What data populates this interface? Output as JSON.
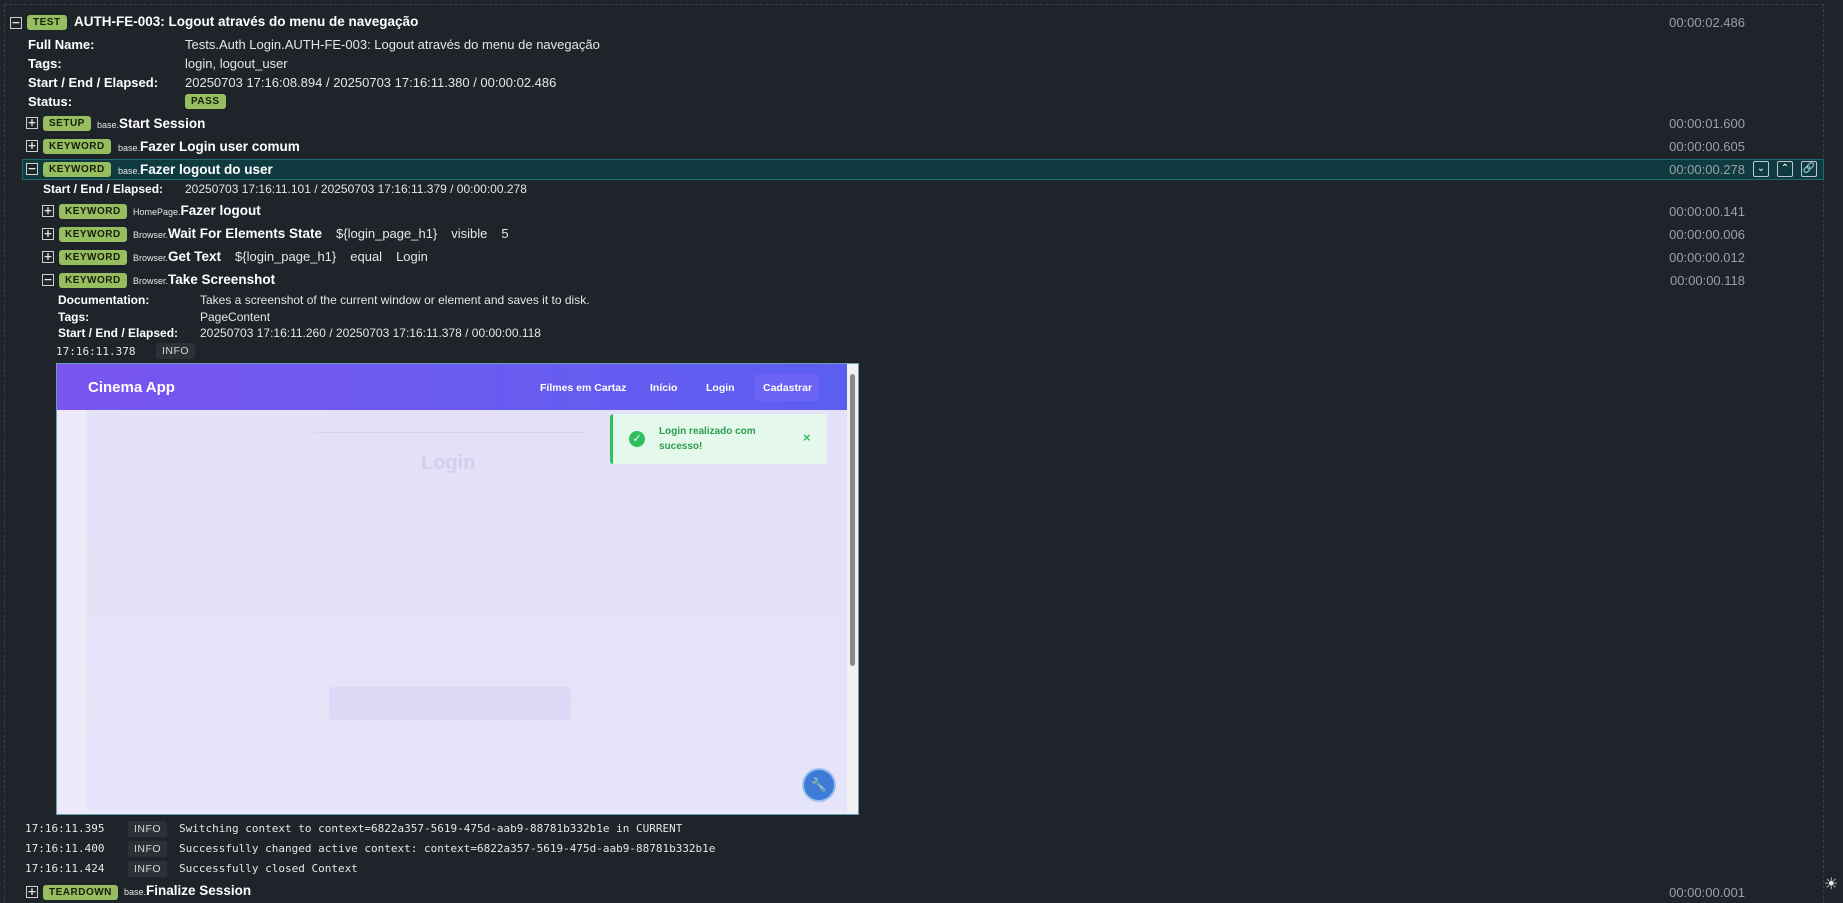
{
  "test": {
    "badge": "TEST",
    "title": "AUTH-FE-003: Logout através do menu de navegação",
    "time": "00:00:02.486",
    "full_name_label": "Full Name:",
    "full_name": "Tests.Auth Login.AUTH-FE-003: Logout através do menu de navegação",
    "tags_label": "Tags:",
    "tags": "login, logout_user",
    "sea_label": "Start / End / Elapsed:",
    "sea": "20250703 17:16:08.894 / 20250703 17:16:11.380 / 00:00:02.486",
    "status_label": "Status:",
    "status": "PASS"
  },
  "rows": {
    "setup": {
      "badge": "SETUP",
      "lib": "base.",
      "name": "Start Session",
      "time": "00:00:01.600"
    },
    "login": {
      "badge": "KEYWORD",
      "lib": "base.",
      "name": "Fazer Login user comum",
      "time": "00:00:00.605"
    },
    "logout": {
      "badge": "KEYWORD",
      "lib": "base.",
      "name": "Fazer logout do user",
      "time": "00:00:00.278",
      "sea_label": "Start / End / Elapsed:",
      "sea": "20250703 17:16:11.101 / 20250703 17:16:11.379 / 00:00:00.278"
    },
    "k1": {
      "badge": "KEYWORD",
      "lib": "HomePage.",
      "name": "Fazer logout",
      "time": "00:00:00.141"
    },
    "k2": {
      "badge": "KEYWORD",
      "lib": "Browser.",
      "name": "Wait For Elements State",
      "a1": "${login_page_h1}",
      "a2": "visible",
      "a3": "5",
      "time": "00:00:00.006"
    },
    "k3": {
      "badge": "KEYWORD",
      "lib": "Browser.",
      "name": "Get Text",
      "a1": "${login_page_h1}",
      "a2": "equal",
      "a3": "Login",
      "time": "00:00:00.012"
    },
    "k4": {
      "badge": "KEYWORD",
      "lib": "Browser.",
      "name": "Take Screenshot",
      "time": "00:00:00.118",
      "doc_label": "Documentation:",
      "doc": "Takes a screenshot of the current window or element and saves it to disk.",
      "tags_label": "Tags:",
      "tags": "PageContent",
      "sea_label": "Start / End / Elapsed:",
      "sea": "20250703 17:16:11.260 / 20250703 17:16:11.378 / 00:00:00.118",
      "msg_time": "17:16:11.378",
      "msg_level": "INFO"
    },
    "teardown": {
      "badge": "TEARDOWN",
      "lib": "base.",
      "name": "Finalize Session",
      "time": "00:00:00.001"
    }
  },
  "screenshot": {
    "brand": "Cinema App",
    "nav": [
      "Filmes em Cartaz",
      "Início",
      "Login",
      "Cadastrar"
    ],
    "toast": "Login realizado com sucesso!",
    "toast_close": "×",
    "heading": "Login"
  },
  "messages": [
    {
      "time": "17:16:11.395",
      "level": "INFO",
      "text": "Switching context to context=6822a357-5619-475d-aab9-88781b332b1e in CURRENT"
    },
    {
      "time": "17:16:11.400",
      "level": "INFO",
      "text": "Successfully changed active context: context=6822a357-5619-475d-aab9-88781b332b1e"
    },
    {
      "time": "17:16:11.424",
      "level": "INFO",
      "text": "Successfully closed Context"
    }
  ],
  "icons": {
    "expand": "+",
    "collapse": "−"
  },
  "colors": {
    "pass_badge": "#97bd61",
    "highlight": "#0e3a40",
    "background": "#1f232a"
  }
}
